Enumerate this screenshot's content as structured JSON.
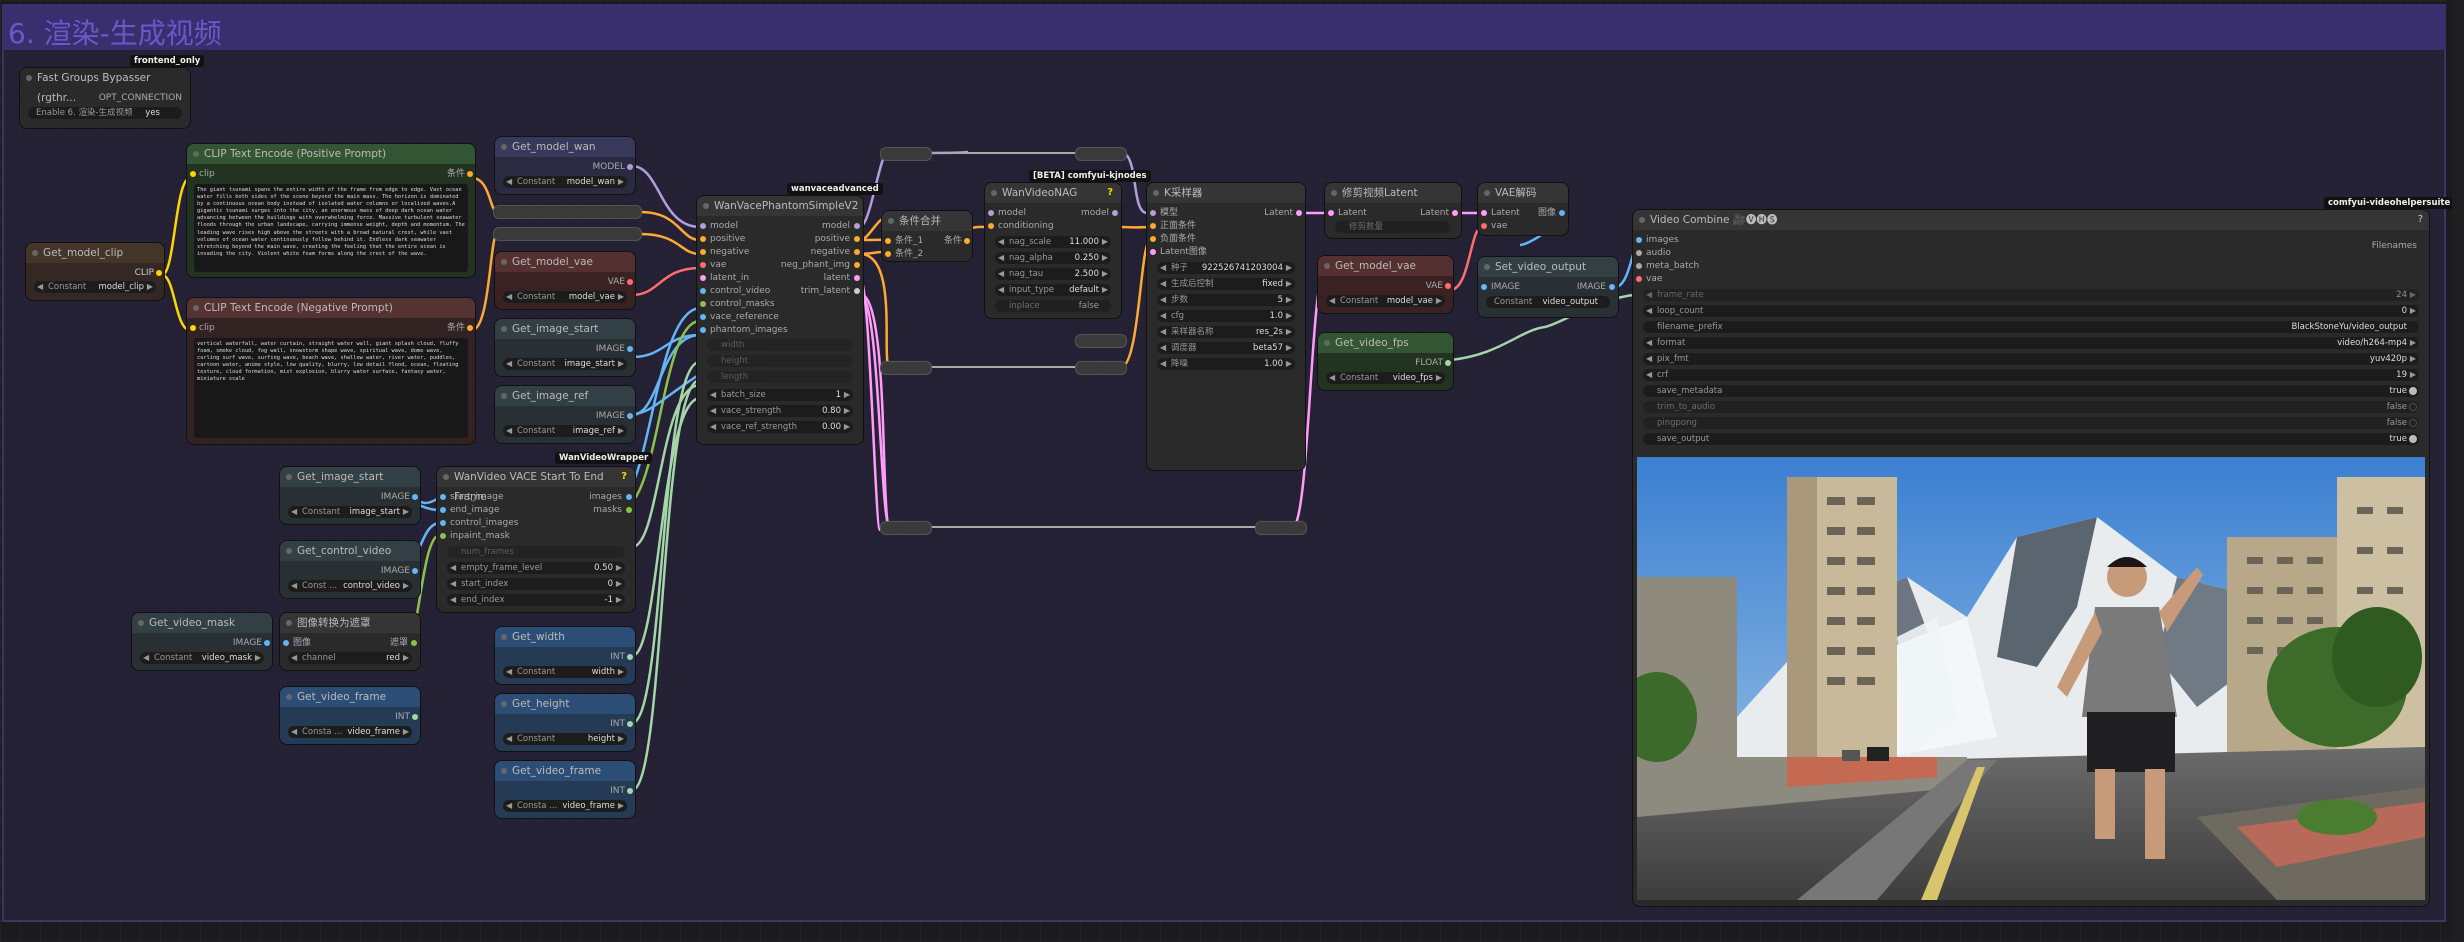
{
  "group_title": "6. 渲染-生成视频",
  "tags": {
    "frontend": "frontend_only",
    "wanvace": "wanvaceadvanced",
    "kjnodes": "[BETA] comfyui-kjnodes",
    "wrapper": "WanVideoWrapper",
    "videohelper": "comfyui-videohelpersuite"
  },
  "bypasser": {
    "title": "Fast Groups Bypasser (rgthr...",
    "out": "OPT_CONNECTION",
    "toggle_label": "Enable 6. 渲染-生成视频",
    "toggle_value": "yes"
  },
  "get_model_clip": {
    "title": "Get_model_clip",
    "out": "CLIP",
    "const": "Constant",
    "value": "model_clip"
  },
  "clip_pos": {
    "title": "CLIP Text Encode (Positive Prompt)",
    "in": "clip",
    "out": "条件",
    "text": "The giant tsunami spans the entire width of the frame from edge to edge. Vast ocean water fills both sides of the scene beyond the main mass. The horizon is dominated by a continuous ocean body instead of isolated water columns or localized waves.A gigantic tsunami surges into the city, an enormous mass of deep dark ocean water advancing between the buildings with overwhelming force. Massive turbulent seawater floods through the urban landscape, carrying immense weight, depth and momentum. The leading wave rises high above the streets with a broad natural crest, while vast volumes of ocean water continuously follow behind it. Endless dark seawater stretching beyond the main wave, creating the feeling that the entire ocean is invading the city. Violent white foam forms along the crest of the wave."
  },
  "clip_neg": {
    "title": "CLIP Text Encode (Negative Prompt)",
    "in": "clip",
    "out": "条件",
    "text": "vertical waterfall, water curtain, straight water wall, giant splash cloud, fluffy foam, smoke cloud, fog wall, snowstorm shape wave, spiritual wave, dome wave, curling surf wave, surfing wave, beach wave, shallow water, river water, puddles, cartoon water, anime style, low quality, blurry, low detail flood, ocean, floating texture, cloud formation, mist explosion, blurry water surface, fantasy water, miniature scale"
  },
  "get_model_wan": {
    "title": "Get_model_wan",
    "out": "MODEL",
    "const": "Constant",
    "value": "model_wan"
  },
  "get_model_vae": {
    "title": "Get_model_vae",
    "out": "VAE",
    "const": "Constant",
    "value": "model_vae"
  },
  "get_image_start": {
    "title": "Get_image_start",
    "out": "IMAGE",
    "const": "Constant",
    "value": "image_start"
  },
  "get_image_ref": {
    "title": "Get_image_ref",
    "out": "IMAGE",
    "const": "Constant",
    "value": "image_ref"
  },
  "phantom": {
    "title": "WanVacePhantomSimpleV2",
    "inputs": [
      "model",
      "positive",
      "negative",
      "vae",
      "latent_in",
      "control_video",
      "control_masks",
      "vace_reference",
      "phantom_images"
    ],
    "outputs": [
      "model",
      "positive",
      "negative",
      "neg_phant_img",
      "latent",
      "trim_latent"
    ],
    "disabled": [
      "width",
      "height",
      "length"
    ],
    "widgets": [
      {
        "label": "batch_size",
        "value": "1"
      },
      {
        "label": "vace_strength",
        "value": "0.80"
      },
      {
        "label": "vace_ref_strength",
        "value": "0.00"
      }
    ]
  },
  "cond_merge": {
    "title": "条件合并",
    "in1": "条件_1",
    "in2": "条件_2",
    "out": "条件"
  },
  "nag": {
    "title": "WanVideoNAG",
    "inputs": [
      "model",
      "conditioning"
    ],
    "out": "model",
    "widgets": [
      {
        "label": "nag_scale",
        "value": "11.000"
      },
      {
        "label": "nag_alpha",
        "value": "0.250"
      },
      {
        "label": "nag_tau",
        "value": "2.500"
      },
      {
        "label": "input_type",
        "value": "default"
      },
      {
        "label": "inplace",
        "value": "false"
      }
    ]
  },
  "ksampler": {
    "title": "K采样器",
    "inputs": [
      "模型",
      "正面条件",
      "负面条件",
      "Latent图像"
    ],
    "out": "Latent",
    "widgets": [
      {
        "label": "种子",
        "value": "922526741203004"
      },
      {
        "label": "生成后控制",
        "value": "fixed"
      },
      {
        "label": "步数",
        "value": "5"
      },
      {
        "label": "cfg",
        "value": "1.0"
      },
      {
        "label": "采样器名称",
        "value": "res_2s"
      },
      {
        "label": "调度器",
        "value": "beta57"
      },
      {
        "label": "降噪",
        "value": "1.00"
      }
    ]
  },
  "crop_latent": {
    "title": "修剪视频Latent",
    "in": "Latent",
    "out": "Latent",
    "widget": "修剪数量"
  },
  "vae_decode": {
    "title": "VAE解码",
    "in1": "Latent",
    "in2": "vae",
    "out": "图像"
  },
  "get_model_vae2": {
    "title": "Get_model_vae",
    "out": "VAE",
    "const": "Constant",
    "value": "model_vae"
  },
  "get_video_fps": {
    "title": "Get_video_fps",
    "out": "FLOAT",
    "const": "Constant",
    "value": "video_fps"
  },
  "set_video_output": {
    "title": "Set_video_output",
    "in": "IMAGE",
    "out": "IMAGE",
    "const": "Constant",
    "value": "video_output"
  },
  "video_combine": {
    "title": "Video Combine 🎥🅥🅗🅢",
    "inputs": [
      "images",
      "audio",
      "meta_batch",
      "vae"
    ],
    "out": "Filenames",
    "widgets": [
      {
        "label": "frame_rate",
        "value": "24"
      },
      {
        "label": "loop_count",
        "value": "0"
      },
      {
        "label": "filename_prefix",
        "value": "BlackStoneYu/video_output"
      },
      {
        "label": "format",
        "value": "video/h264-mp4"
      },
      {
        "label": "pix_fmt",
        "value": "yuv420p"
      },
      {
        "label": "crf",
        "value": "19"
      },
      {
        "label": "save_metadata",
        "value": "true"
      },
      {
        "label": "trim_to_audio",
        "value": "false"
      },
      {
        "label": "pingpong",
        "value": "false"
      },
      {
        "label": "save_output",
        "value": "true"
      }
    ]
  },
  "get_image_start2": {
    "title": "Get_image_start",
    "out": "IMAGE",
    "const": "Constant",
    "value": "image_start"
  },
  "get_control_video": {
    "title": "Get_control_video",
    "out": "IMAGE",
    "const": "Const ...",
    "value": "control_video"
  },
  "get_video_mask": {
    "title": "Get_video_mask",
    "out": "IMAGE",
    "const": "Constant",
    "value": "video_mask"
  },
  "img_to_mask": {
    "title": "图像转换为遮罩",
    "in": "图像",
    "out": "遮罩",
    "widget_label": "channel",
    "widget_value": "red"
  },
  "get_video_frame": {
    "title": "Get_video_frame",
    "out": "INT",
    "const": "Consta ...",
    "value": "video_frame"
  },
  "vace_start_end": {
    "title": "WanVideo VACE Start To End Frame",
    "inputs": [
      "start_image",
      "end_image",
      "control_images",
      "inpaint_mask"
    ],
    "outputs": [
      "images",
      "masks"
    ],
    "disabled": "num_frames",
    "widgets": [
      {
        "label": "empty_frame_level",
        "value": "0.50"
      },
      {
        "label": "start_index",
        "value": "0"
      },
      {
        "label": "end_index",
        "value": "-1"
      }
    ]
  },
  "get_width": {
    "title": "Get_width",
    "out": "INT",
    "const": "Constant",
    "value": "width"
  },
  "get_height": {
    "title": "Get_height",
    "out": "INT",
    "const": "Constant",
    "value": "height"
  },
  "get_video_frame2": {
    "title": "Get_video_frame",
    "out": "INT",
    "const": "Consta ...",
    "value": "video_frame"
  }
}
